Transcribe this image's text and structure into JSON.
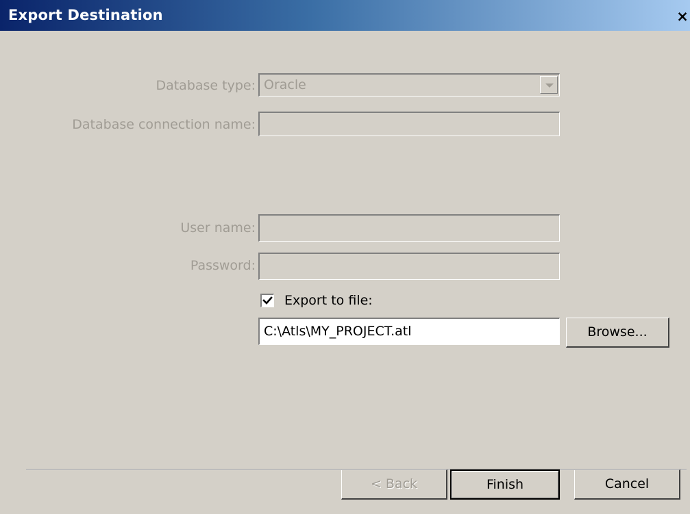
{
  "window": {
    "title": "Export Destination",
    "close_symbol": "×"
  },
  "form": {
    "database_type": {
      "label": "Database type:",
      "value": "Oracle",
      "enabled": false
    },
    "connection_name": {
      "label": "Database connection name:",
      "value": "",
      "enabled": false
    },
    "user_name": {
      "label": "User name:",
      "value": "",
      "enabled": false
    },
    "password": {
      "label": "Password:",
      "value": "",
      "enabled": false
    },
    "export_to_file": {
      "label": "Export to file:",
      "checked": true
    },
    "file_path": {
      "value": "C:\\Atls\\MY_PROJECT.atl"
    },
    "browse_label": "Browse..."
  },
  "footer": {
    "back_label": "< Back",
    "finish_label": "Finish",
    "cancel_label": "Cancel"
  },
  "icons": {
    "close": "close-icon",
    "dropdown": "chevron-down-icon",
    "check": "checkmark-icon"
  },
  "colors": {
    "title_gradient_start": "#0a246a",
    "title_gradient_end": "#a6caf0",
    "dialog_background": "#d4d0c8",
    "disabled_text": "#a09c94"
  }
}
